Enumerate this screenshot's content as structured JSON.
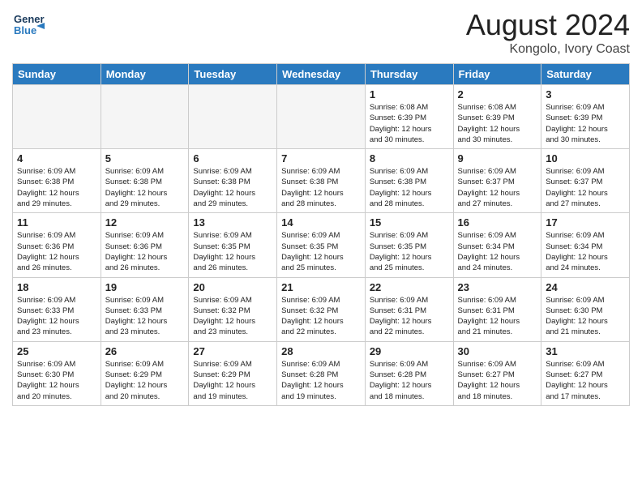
{
  "header": {
    "logo_line1": "General",
    "logo_line2": "Blue",
    "title": "August 2024",
    "subtitle": "Kongolo, Ivory Coast"
  },
  "days_of_week": [
    "Sunday",
    "Monday",
    "Tuesday",
    "Wednesday",
    "Thursday",
    "Friday",
    "Saturday"
  ],
  "weeks": [
    [
      {
        "day": "",
        "info": ""
      },
      {
        "day": "",
        "info": ""
      },
      {
        "day": "",
        "info": ""
      },
      {
        "day": "",
        "info": ""
      },
      {
        "day": "1",
        "info": "Sunrise: 6:08 AM\nSunset: 6:39 PM\nDaylight: 12 hours\nand 30 minutes."
      },
      {
        "day": "2",
        "info": "Sunrise: 6:08 AM\nSunset: 6:39 PM\nDaylight: 12 hours\nand 30 minutes."
      },
      {
        "day": "3",
        "info": "Sunrise: 6:09 AM\nSunset: 6:39 PM\nDaylight: 12 hours\nand 30 minutes."
      }
    ],
    [
      {
        "day": "4",
        "info": "Sunrise: 6:09 AM\nSunset: 6:38 PM\nDaylight: 12 hours\nand 29 minutes."
      },
      {
        "day": "5",
        "info": "Sunrise: 6:09 AM\nSunset: 6:38 PM\nDaylight: 12 hours\nand 29 minutes."
      },
      {
        "day": "6",
        "info": "Sunrise: 6:09 AM\nSunset: 6:38 PM\nDaylight: 12 hours\nand 29 minutes."
      },
      {
        "day": "7",
        "info": "Sunrise: 6:09 AM\nSunset: 6:38 PM\nDaylight: 12 hours\nand 28 minutes."
      },
      {
        "day": "8",
        "info": "Sunrise: 6:09 AM\nSunset: 6:38 PM\nDaylight: 12 hours\nand 28 minutes."
      },
      {
        "day": "9",
        "info": "Sunrise: 6:09 AM\nSunset: 6:37 PM\nDaylight: 12 hours\nand 27 minutes."
      },
      {
        "day": "10",
        "info": "Sunrise: 6:09 AM\nSunset: 6:37 PM\nDaylight: 12 hours\nand 27 minutes."
      }
    ],
    [
      {
        "day": "11",
        "info": "Sunrise: 6:09 AM\nSunset: 6:36 PM\nDaylight: 12 hours\nand 26 minutes."
      },
      {
        "day": "12",
        "info": "Sunrise: 6:09 AM\nSunset: 6:36 PM\nDaylight: 12 hours\nand 26 minutes."
      },
      {
        "day": "13",
        "info": "Sunrise: 6:09 AM\nSunset: 6:35 PM\nDaylight: 12 hours\nand 26 minutes."
      },
      {
        "day": "14",
        "info": "Sunrise: 6:09 AM\nSunset: 6:35 PM\nDaylight: 12 hours\nand 25 minutes."
      },
      {
        "day": "15",
        "info": "Sunrise: 6:09 AM\nSunset: 6:35 PM\nDaylight: 12 hours\nand 25 minutes."
      },
      {
        "day": "16",
        "info": "Sunrise: 6:09 AM\nSunset: 6:34 PM\nDaylight: 12 hours\nand 24 minutes."
      },
      {
        "day": "17",
        "info": "Sunrise: 6:09 AM\nSunset: 6:34 PM\nDaylight: 12 hours\nand 24 minutes."
      }
    ],
    [
      {
        "day": "18",
        "info": "Sunrise: 6:09 AM\nSunset: 6:33 PM\nDaylight: 12 hours\nand 23 minutes."
      },
      {
        "day": "19",
        "info": "Sunrise: 6:09 AM\nSunset: 6:33 PM\nDaylight: 12 hours\nand 23 minutes."
      },
      {
        "day": "20",
        "info": "Sunrise: 6:09 AM\nSunset: 6:32 PM\nDaylight: 12 hours\nand 23 minutes."
      },
      {
        "day": "21",
        "info": "Sunrise: 6:09 AM\nSunset: 6:32 PM\nDaylight: 12 hours\nand 22 minutes."
      },
      {
        "day": "22",
        "info": "Sunrise: 6:09 AM\nSunset: 6:31 PM\nDaylight: 12 hours\nand 22 minutes."
      },
      {
        "day": "23",
        "info": "Sunrise: 6:09 AM\nSunset: 6:31 PM\nDaylight: 12 hours\nand 21 minutes."
      },
      {
        "day": "24",
        "info": "Sunrise: 6:09 AM\nSunset: 6:30 PM\nDaylight: 12 hours\nand 21 minutes."
      }
    ],
    [
      {
        "day": "25",
        "info": "Sunrise: 6:09 AM\nSunset: 6:30 PM\nDaylight: 12 hours\nand 20 minutes."
      },
      {
        "day": "26",
        "info": "Sunrise: 6:09 AM\nSunset: 6:29 PM\nDaylight: 12 hours\nand 20 minutes."
      },
      {
        "day": "27",
        "info": "Sunrise: 6:09 AM\nSunset: 6:29 PM\nDaylight: 12 hours\nand 19 minutes."
      },
      {
        "day": "28",
        "info": "Sunrise: 6:09 AM\nSunset: 6:28 PM\nDaylight: 12 hours\nand 19 minutes."
      },
      {
        "day": "29",
        "info": "Sunrise: 6:09 AM\nSunset: 6:28 PM\nDaylight: 12 hours\nand 18 minutes."
      },
      {
        "day": "30",
        "info": "Sunrise: 6:09 AM\nSunset: 6:27 PM\nDaylight: 12 hours\nand 18 minutes."
      },
      {
        "day": "31",
        "info": "Sunrise: 6:09 AM\nSunset: 6:27 PM\nDaylight: 12 hours\nand 17 minutes."
      }
    ]
  ]
}
